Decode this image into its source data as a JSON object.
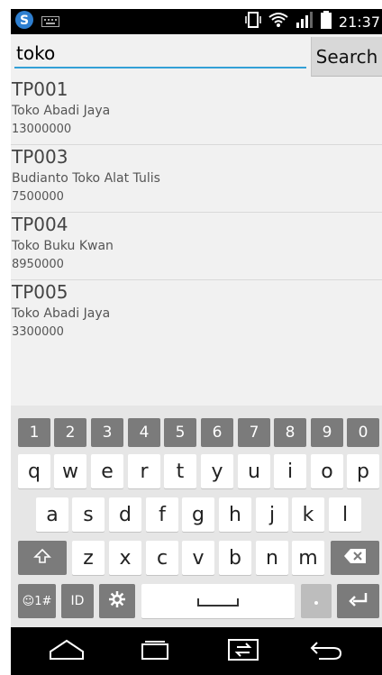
{
  "status_bar": {
    "time": "21:37",
    "icons": [
      "app-s-icon",
      "keyboard-notification-icon",
      "vibrate-icon",
      "wifi-icon",
      "signal-icon",
      "battery-icon"
    ]
  },
  "search": {
    "value": "toko",
    "button_label": "Search"
  },
  "results": [
    {
      "code": "TP001",
      "name": "Toko Abadi Jaya",
      "price": "13000000"
    },
    {
      "code": "TP003",
      "name": "Budianto Toko Alat Tulis",
      "price": "7500000"
    },
    {
      "code": "TP004",
      "name": "Toko Buku Kwan",
      "price": "8950000"
    },
    {
      "code": "TP005",
      "name": "Toko Abadi Jaya",
      "price": "3300000"
    }
  ],
  "keyboard": {
    "numbers": [
      "1",
      "2",
      "3",
      "4",
      "5",
      "6",
      "7",
      "8",
      "9",
      "0"
    ],
    "row1": [
      "q",
      "w",
      "e",
      "r",
      "t",
      "y",
      "u",
      "i",
      "o",
      "p"
    ],
    "row2": [
      "a",
      "s",
      "d",
      "f",
      "g",
      "h",
      "j",
      "k",
      "l"
    ],
    "row3": [
      "z",
      "x",
      "c",
      "v",
      "b",
      "n",
      "m"
    ],
    "symbols_label": "☺1#",
    "id_label": "ID",
    "accent_color": "#33a0d6"
  },
  "nav_bar": {
    "icons": [
      "home-icon",
      "recent-apps-icon",
      "dual-window-icon",
      "back-icon"
    ]
  }
}
